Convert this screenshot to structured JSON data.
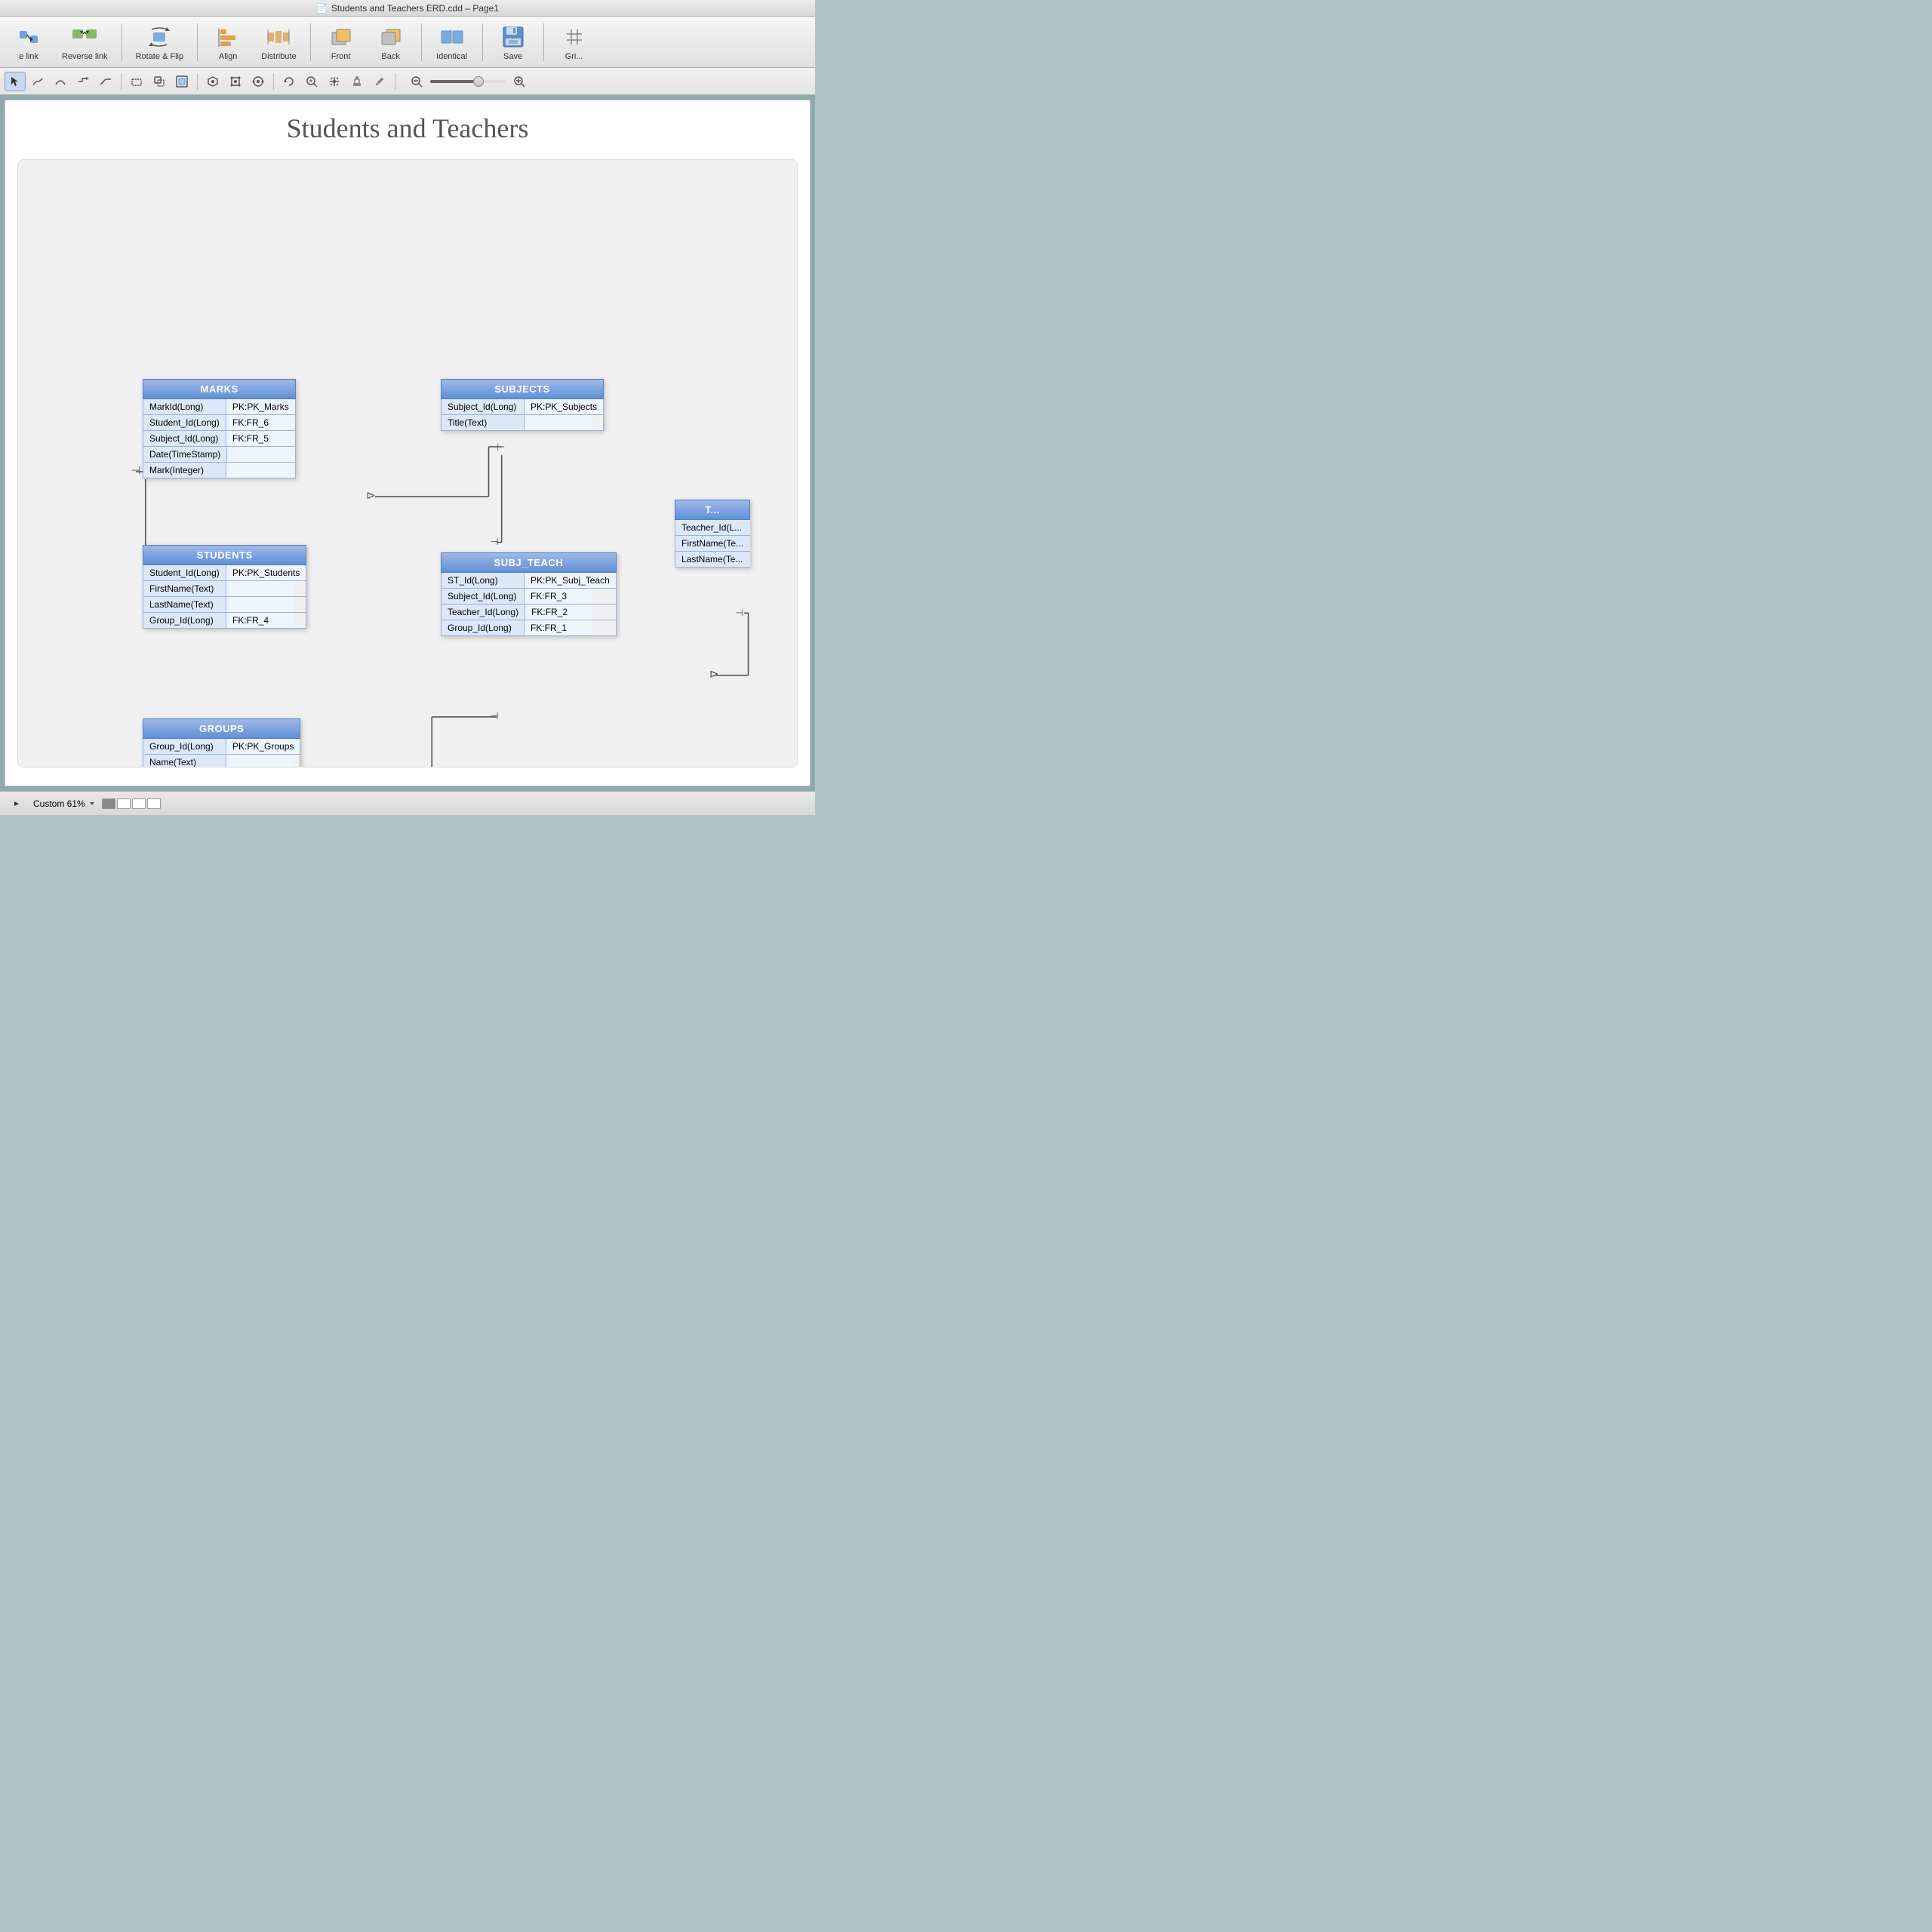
{
  "titleBar": {
    "title": "Students and Teachers ERD.cdd – Page1",
    "fileIcon": "📄"
  },
  "toolbar": {
    "items": [
      {
        "id": "reverse-link",
        "label": "Reverse link"
      },
      {
        "id": "rotate-flip",
        "label": "Rotate & Flip"
      },
      {
        "id": "align",
        "label": "Align"
      },
      {
        "id": "distribute",
        "label": "Distribute"
      },
      {
        "id": "front",
        "label": "Front"
      },
      {
        "id": "back",
        "label": "Back"
      },
      {
        "id": "identical",
        "label": "Identical"
      },
      {
        "id": "save",
        "label": "Save"
      },
      {
        "id": "grid",
        "label": "Grid"
      }
    ]
  },
  "diagram": {
    "title": "Students and Teachers",
    "tables": {
      "marks": {
        "name": "MARKS",
        "rows": [
          {
            "left": "MarkId(Long)",
            "right": "PK:PK_Marks"
          },
          {
            "left": "Student_Id(Long)",
            "right": "FK:FR_6"
          },
          {
            "left": "Subject_Id(Long)",
            "right": "FK:FR_5"
          },
          {
            "left": "Date(TimeStamp)",
            "right": ""
          },
          {
            "left": "Mark(Integer)",
            "right": ""
          }
        ]
      },
      "subjects": {
        "name": "SUBJECTS",
        "rows": [
          {
            "left": "Subject_Id(Long)",
            "right": "PK:PK_Subjects"
          },
          {
            "left": "Title(Text)",
            "right": ""
          }
        ]
      },
      "students": {
        "name": "STUDENTS",
        "rows": [
          {
            "left": "Student_Id(Long)",
            "right": "PK:PK_Students"
          },
          {
            "left": "FirstName(Text)",
            "right": ""
          },
          {
            "left": "LastName(Text)",
            "right": ""
          },
          {
            "left": "Group_Id(Long)",
            "right": "FK:FR_4"
          }
        ]
      },
      "subj_teach": {
        "name": "SUBJ_TEACH",
        "rows": [
          {
            "left": "ST_Id(Long)",
            "right": "PK:PK_Subj_Teach"
          },
          {
            "left": "Subject_Id(Long)",
            "right": "FK:FR_3"
          },
          {
            "left": "Teacher_Id(Long)",
            "right": "FK:FR_2"
          },
          {
            "left": "Group_Id(Long)",
            "right": "FK:FR_1"
          }
        ]
      },
      "groups": {
        "name": "GROUPS",
        "rows": [
          {
            "left": "Group_Id(Long)",
            "right": "PK:PK_Groups"
          },
          {
            "left": "Name(Text)",
            "right": ""
          }
        ]
      },
      "teachers": {
        "name": "T...",
        "rows": [
          {
            "left": "Teacher_Id(L...",
            "right": ""
          },
          {
            "left": "FirstName(Te...",
            "right": ""
          },
          {
            "left": "LastName(Te...",
            "right": ""
          }
        ]
      }
    }
  },
  "statusBar": {
    "zoom": "Custom 61%",
    "pages": [
      "page1",
      "page2",
      "page3",
      "page4"
    ]
  }
}
